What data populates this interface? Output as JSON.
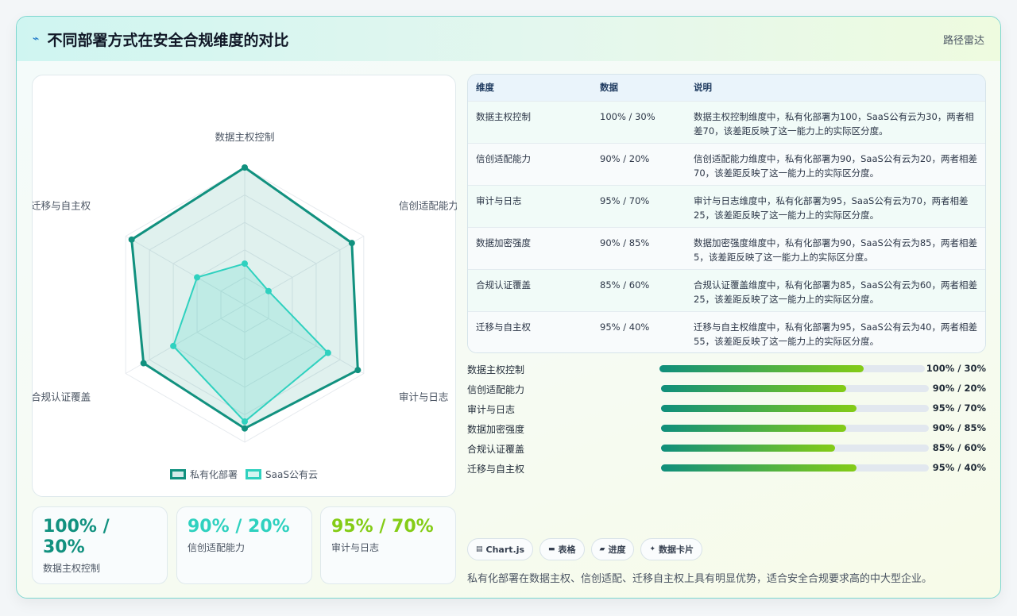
{
  "header": {
    "title": "不同部署方式在安全合规维度的对比",
    "right_label": "路径雷达",
    "icon": "bolt-icon"
  },
  "chart_data": {
    "type": "radar",
    "categories": [
      "数据主权控制",
      "信创适配能力",
      "审计与日志",
      "数据加密强度",
      "合规认证覆盖",
      "迁移与自主权"
    ],
    "series": [
      {
        "name": "私有化部署",
        "values": [
          100,
          90,
          95,
          90,
          85,
          95
        ],
        "color": "#11917f"
      },
      {
        "name": "SaaS公有云",
        "values": [
          30,
          20,
          70,
          85,
          60,
          40
        ],
        "color": "#2fd1bf"
      }
    ],
    "rlim": [
      0,
      100
    ],
    "legend_position": "bottom"
  },
  "stats": [
    {
      "value": "100% / 30%",
      "label": "数据主权控制",
      "color": "#11917f"
    },
    {
      "value": "90% / 20%",
      "label": "信创适配能力",
      "color": "#2fd1bf"
    },
    {
      "value": "95% / 70%",
      "label": "审计与日志",
      "color": "#84cc16"
    }
  ],
  "table": {
    "headers": [
      "维度",
      "数据",
      "说明"
    ],
    "rows": [
      [
        "数据主权控制",
        "100% / 30%",
        "数据主权控制维度中，私有化部署为100，SaaS公有云为30，两者相差70，该差距反映了这一能力上的实际区分度。"
      ],
      [
        "信创适配能力",
        "90% / 20%",
        "信创适配能力维度中，私有化部署为90，SaaS公有云为20，两者相差70，该差距反映了这一能力上的实际区分度。"
      ],
      [
        "审计与日志",
        "95% / 70%",
        "审计与日志维度中，私有化部署为95，SaaS公有云为70，两者相差25，该差距反映了这一能力上的实际区分度。"
      ],
      [
        "数据加密强度",
        "90% / 85%",
        "数据加密强度维度中，私有化部署为90，SaaS公有云为85，两者相差5，该差距反映了这一能力上的实际区分度。"
      ],
      [
        "合规认证覆盖",
        "85% / 60%",
        "合规认证覆盖维度中，私有化部署为85，SaaS公有云为60，两者相差25，该差距反映了这一能力上的实际区分度。"
      ],
      [
        "迁移与自主权",
        "95% / 40%",
        "迁移与自主权维度中，私有化部署为95，SaaS公有云为40，两者相差55，该差距反映了这一能力上的实际区分度。"
      ]
    ]
  },
  "progress": [
    {
      "label": "数据主权控制",
      "text": "100% / 30%",
      "fill": 0.77
    },
    {
      "label": "信创适配能力",
      "text": "90% / 20%",
      "fill": 0.69
    },
    {
      "label": "审计与日志",
      "text": "95% / 70%",
      "fill": 0.73
    },
    {
      "label": "数据加密强度",
      "text": "90% / 85%",
      "fill": 0.69
    },
    {
      "label": "合规认证覆盖",
      "text": "85% / 60%",
      "fill": 0.65
    },
    {
      "label": "迁移与自主权",
      "text": "95% / 40%",
      "fill": 0.73
    }
  ],
  "chips": [
    {
      "label": "Chart.js",
      "icon": "chart-icon",
      "glyph": "▤"
    },
    {
      "label": "表格",
      "icon": "table-icon",
      "glyph": "▬"
    },
    {
      "label": "进度",
      "icon": "progress-icon",
      "glyph": "▰"
    },
    {
      "label": "数据卡片",
      "icon": "sparkle-icon",
      "glyph": "✦"
    }
  ],
  "note": "私有化部署在数据主权、信创适配、迁移自主权上具有明显优势，适合安全合规要求高的中大型企业。"
}
